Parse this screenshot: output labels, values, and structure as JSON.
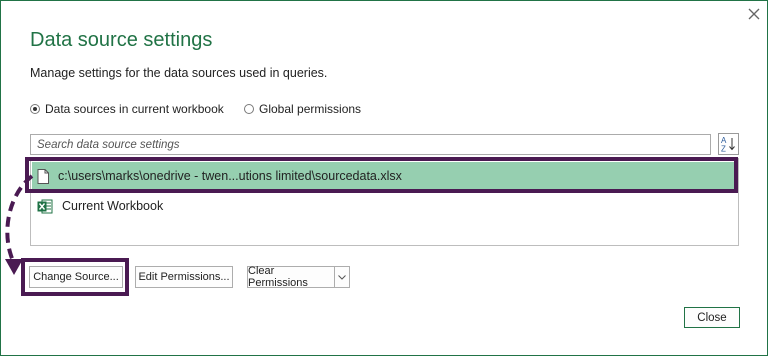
{
  "dialog": {
    "title": "Data source settings",
    "description": "Manage settings for the data sources used in queries.",
    "close_icon": "close-icon"
  },
  "scope": {
    "options": [
      {
        "label": "Data sources in current workbook",
        "selected": true
      },
      {
        "label": "Global permissions",
        "selected": false
      }
    ]
  },
  "search": {
    "placeholder": "Search data source settings",
    "value": "",
    "sort_icon": "sort-az-icon"
  },
  "sources": [
    {
      "label": "c:\\users\\marks\\onedrive - twen...utions limited\\sourcedata.xlsx",
      "icon": "file-icon",
      "selected": true
    },
    {
      "label": "Current Workbook",
      "icon": "excel-icon",
      "selected": false
    }
  ],
  "buttons": {
    "change_source": "Change Source...",
    "edit_permissions": "Edit Permissions...",
    "clear_permissions": "Clear Permissions",
    "close": "Close"
  },
  "colors": {
    "accent": "#217346",
    "selection": "#96cfb0",
    "annotation": "#4a1a52"
  }
}
